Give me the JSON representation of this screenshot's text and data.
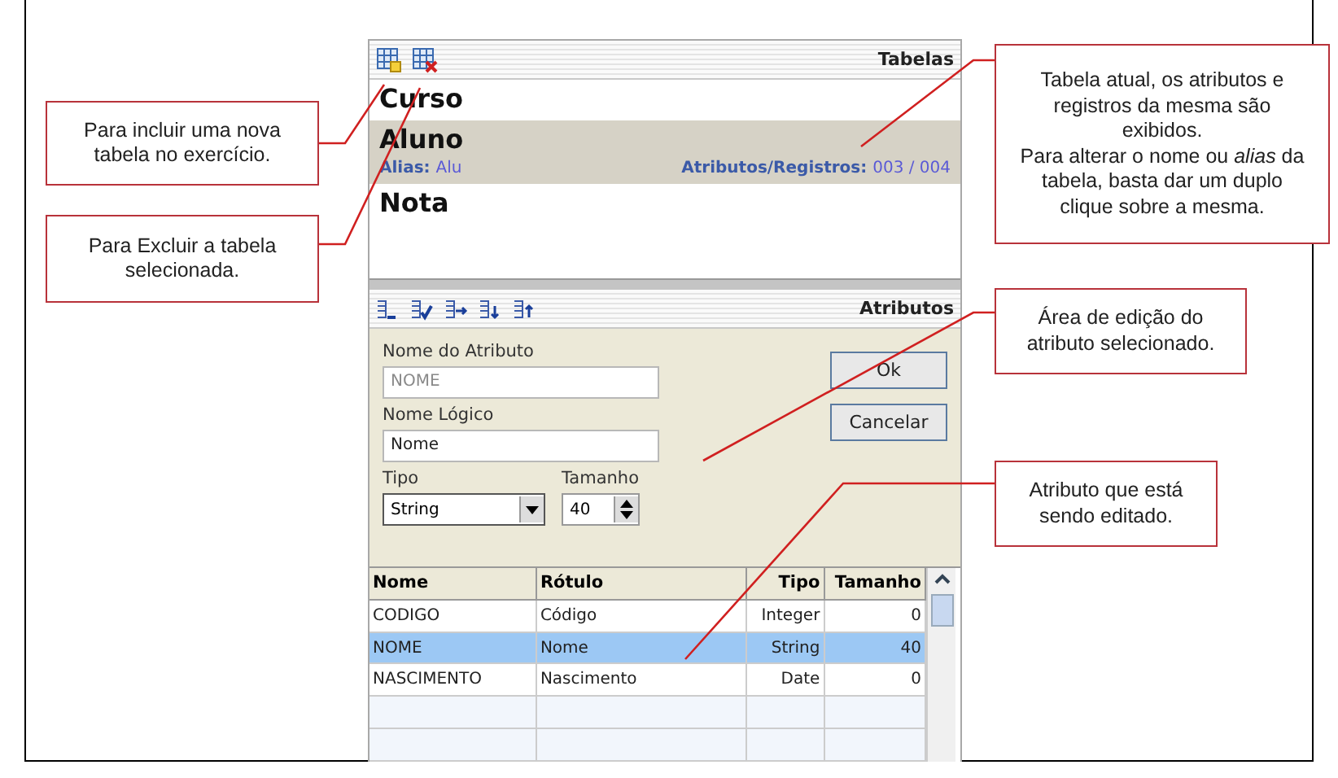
{
  "tables_panel": {
    "title": "Tabelas",
    "tables": [
      {
        "name": "Curso",
        "selected": false
      },
      {
        "name": "Aluno",
        "selected": true,
        "alias_label": "Alias:",
        "alias": "Alu",
        "count_label": "Atributos/Registros:",
        "count": "003 / 004"
      },
      {
        "name": "Nota",
        "selected": false
      }
    ]
  },
  "attributes_panel": {
    "title": "Atributos",
    "fields": [
      {
        "label": "Nome do Atributo",
        "value": "NOME",
        "disabled": true
      },
      {
        "label": "Nome Lógico",
        "value": "Nome",
        "disabled": false
      }
    ],
    "type": {
      "label": "Tipo",
      "value": "String"
    },
    "size": {
      "label": "Tamanho",
      "value": "40"
    },
    "buttons": [
      "Ok",
      "Cancelar"
    ],
    "grid": {
      "columns": [
        "Nome",
        "Rótulo",
        "Tipo",
        "Tamanho"
      ],
      "rows": [
        {
          "cells": [
            "CODIGO",
            "Código",
            "Integer",
            "0"
          ],
          "selected": false
        },
        {
          "cells": [
            "NOME",
            "Nome",
            "String",
            "40"
          ],
          "selected": true
        },
        {
          "cells": [
            "NASCIMENTO",
            "Nascimento",
            "Date",
            "0"
          ],
          "selected": false
        }
      ]
    }
  },
  "callouts": [
    {
      "paragraphs": [
        "Para incluir uma nova tabela no exercício."
      ]
    },
    {
      "paragraphs": [
        "Para Excluir a tabela selecionada."
      ]
    },
    {
      "paragraphs": [
        "Tabela atual, os atributos e registros da mesma são exibidos.",
        "Para alterar o nome ou *alias* da tabela, basta dar um duplo clique sobre a mesma."
      ]
    },
    {
      "paragraphs": [
        "Área de edição do atributo selecionado."
      ]
    },
    {
      "paragraphs": [
        "Atributo que está sendo editado."
      ]
    }
  ]
}
